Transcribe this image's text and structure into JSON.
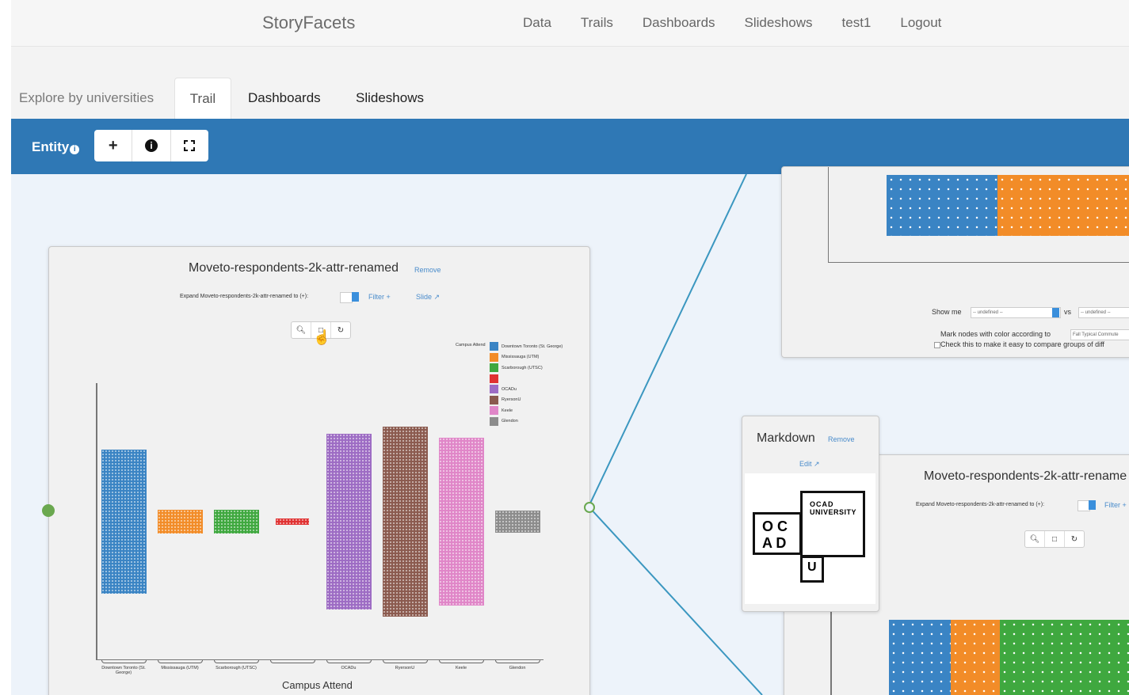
{
  "app": {
    "brand": "StoryFacets"
  },
  "topnav": {
    "links": [
      "Data",
      "Trails",
      "Dashboards",
      "Slideshows",
      "test1",
      "Logout"
    ]
  },
  "tabs": {
    "explore": "Explore by universities",
    "trail": "Trail",
    "dashboards": "Dashboards",
    "slideshows": "Slideshows"
  },
  "toolbar": {
    "entity_label": "Entity",
    "add_icon": "plus-icon",
    "info_icon": "info-circle-icon",
    "fullscreen_icon": "expand-icon"
  },
  "main_panel": {
    "title": "Moveto-respondents-2k-attr-renamed",
    "remove_label": "Remove",
    "expand_label": "Expand Moveto-respondents-2k-attr-renamed to (+):",
    "filter_label": "Filter +",
    "slide_label": "Slide ↗",
    "zoom_buttons": [
      "zoom-in-icon",
      "square-select-icon",
      "reset-icon"
    ],
    "chart_data": {
      "type": "bar",
      "xlabel": "Campus Attend",
      "legend_title": "Campus Attend",
      "legend_position": "top-right",
      "categories": [
        "Downtown Toronto (St. George)",
        "Mississauga (UTM)",
        "Scarborough (UTSC)",
        "",
        "OCADu",
        "RyersonU",
        "Keele",
        "Glendon"
      ],
      "legend": [
        {
          "name": "Downtown Toronto (St. George)",
          "color": "#3a84c4"
        },
        {
          "name": "Mississauga (UTM)",
          "color": "#f28c28"
        },
        {
          "name": "Scarborough (UTSC)",
          "color": "#3fa83f"
        },
        {
          "name": "",
          "color": "#e03232"
        },
        {
          "name": "OCADu",
          "color": "#9d6cc4"
        },
        {
          "name": "RyersonU",
          "color": "#8b5a4f"
        },
        {
          "name": "Keele",
          "color": "#e086c8"
        },
        {
          "name": "Glendon",
          "color": "#8c8c8c"
        }
      ],
      "values": [
        180,
        30,
        30,
        8,
        220,
        238,
        210,
        28
      ]
    }
  },
  "top_right_panel": {
    "show_me_label": "Show me",
    "vs_label": "vs",
    "select_a": "-- undefined --",
    "select_b": "-- undefined --",
    "mark_nodes_label": "Mark nodes with color according to",
    "mark_nodes_value": "Fall Typical Commute",
    "check_label": "Check this to make it easy to compare groups of diff"
  },
  "markdown_panel": {
    "title": "Markdown",
    "remove_label": "Remove",
    "edit_label": "Edit",
    "logo_text": [
      "OCAD",
      "UNIVERSITY",
      "O C",
      "A D",
      "U"
    ]
  },
  "bottom_right_panel": {
    "title": "Moveto-respondents-2k-attr-rename",
    "expand_label": "Expand Moveto-respondents-2k-attr-renamed to (+):",
    "filter_label": "Filter +"
  }
}
